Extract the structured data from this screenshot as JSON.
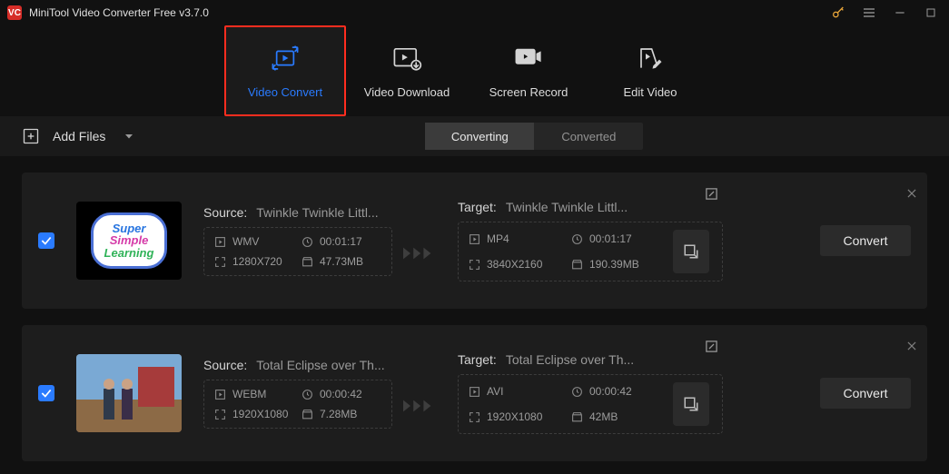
{
  "app": {
    "title": "MiniTool Video Converter Free v3.7.0"
  },
  "nav": {
    "video_convert": "Video Convert",
    "video_download": "Video Download",
    "screen_record": "Screen Record",
    "edit_video": "Edit Video"
  },
  "toolbar": {
    "add_files": "Add Files",
    "tab_converting": "Converting",
    "tab_converted": "Converted"
  },
  "labels": {
    "source": "Source:",
    "target": "Target:",
    "convert": "Convert"
  },
  "thumb1": {
    "l1": "Super",
    "l2": "Simple",
    "l3": "Learning"
  },
  "items": [
    {
      "source_name": "Twinkle Twinkle Littl...",
      "target_name": "Twinkle Twinkle Littl...",
      "src_format": "WMV",
      "src_duration": "00:01:17",
      "src_res": "1280X720",
      "src_size": "47.73MB",
      "tgt_format": "MP4",
      "tgt_duration": "00:01:17",
      "tgt_res": "3840X2160",
      "tgt_size": "190.39MB"
    },
    {
      "source_name": "Total Eclipse over Th...",
      "target_name": "Total Eclipse over Th...",
      "src_format": "WEBM",
      "src_duration": "00:00:42",
      "src_res": "1920X1080",
      "src_size": "7.28MB",
      "tgt_format": "AVI",
      "tgt_duration": "00:00:42",
      "tgt_res": "1920X1080",
      "tgt_size": "42MB"
    }
  ]
}
